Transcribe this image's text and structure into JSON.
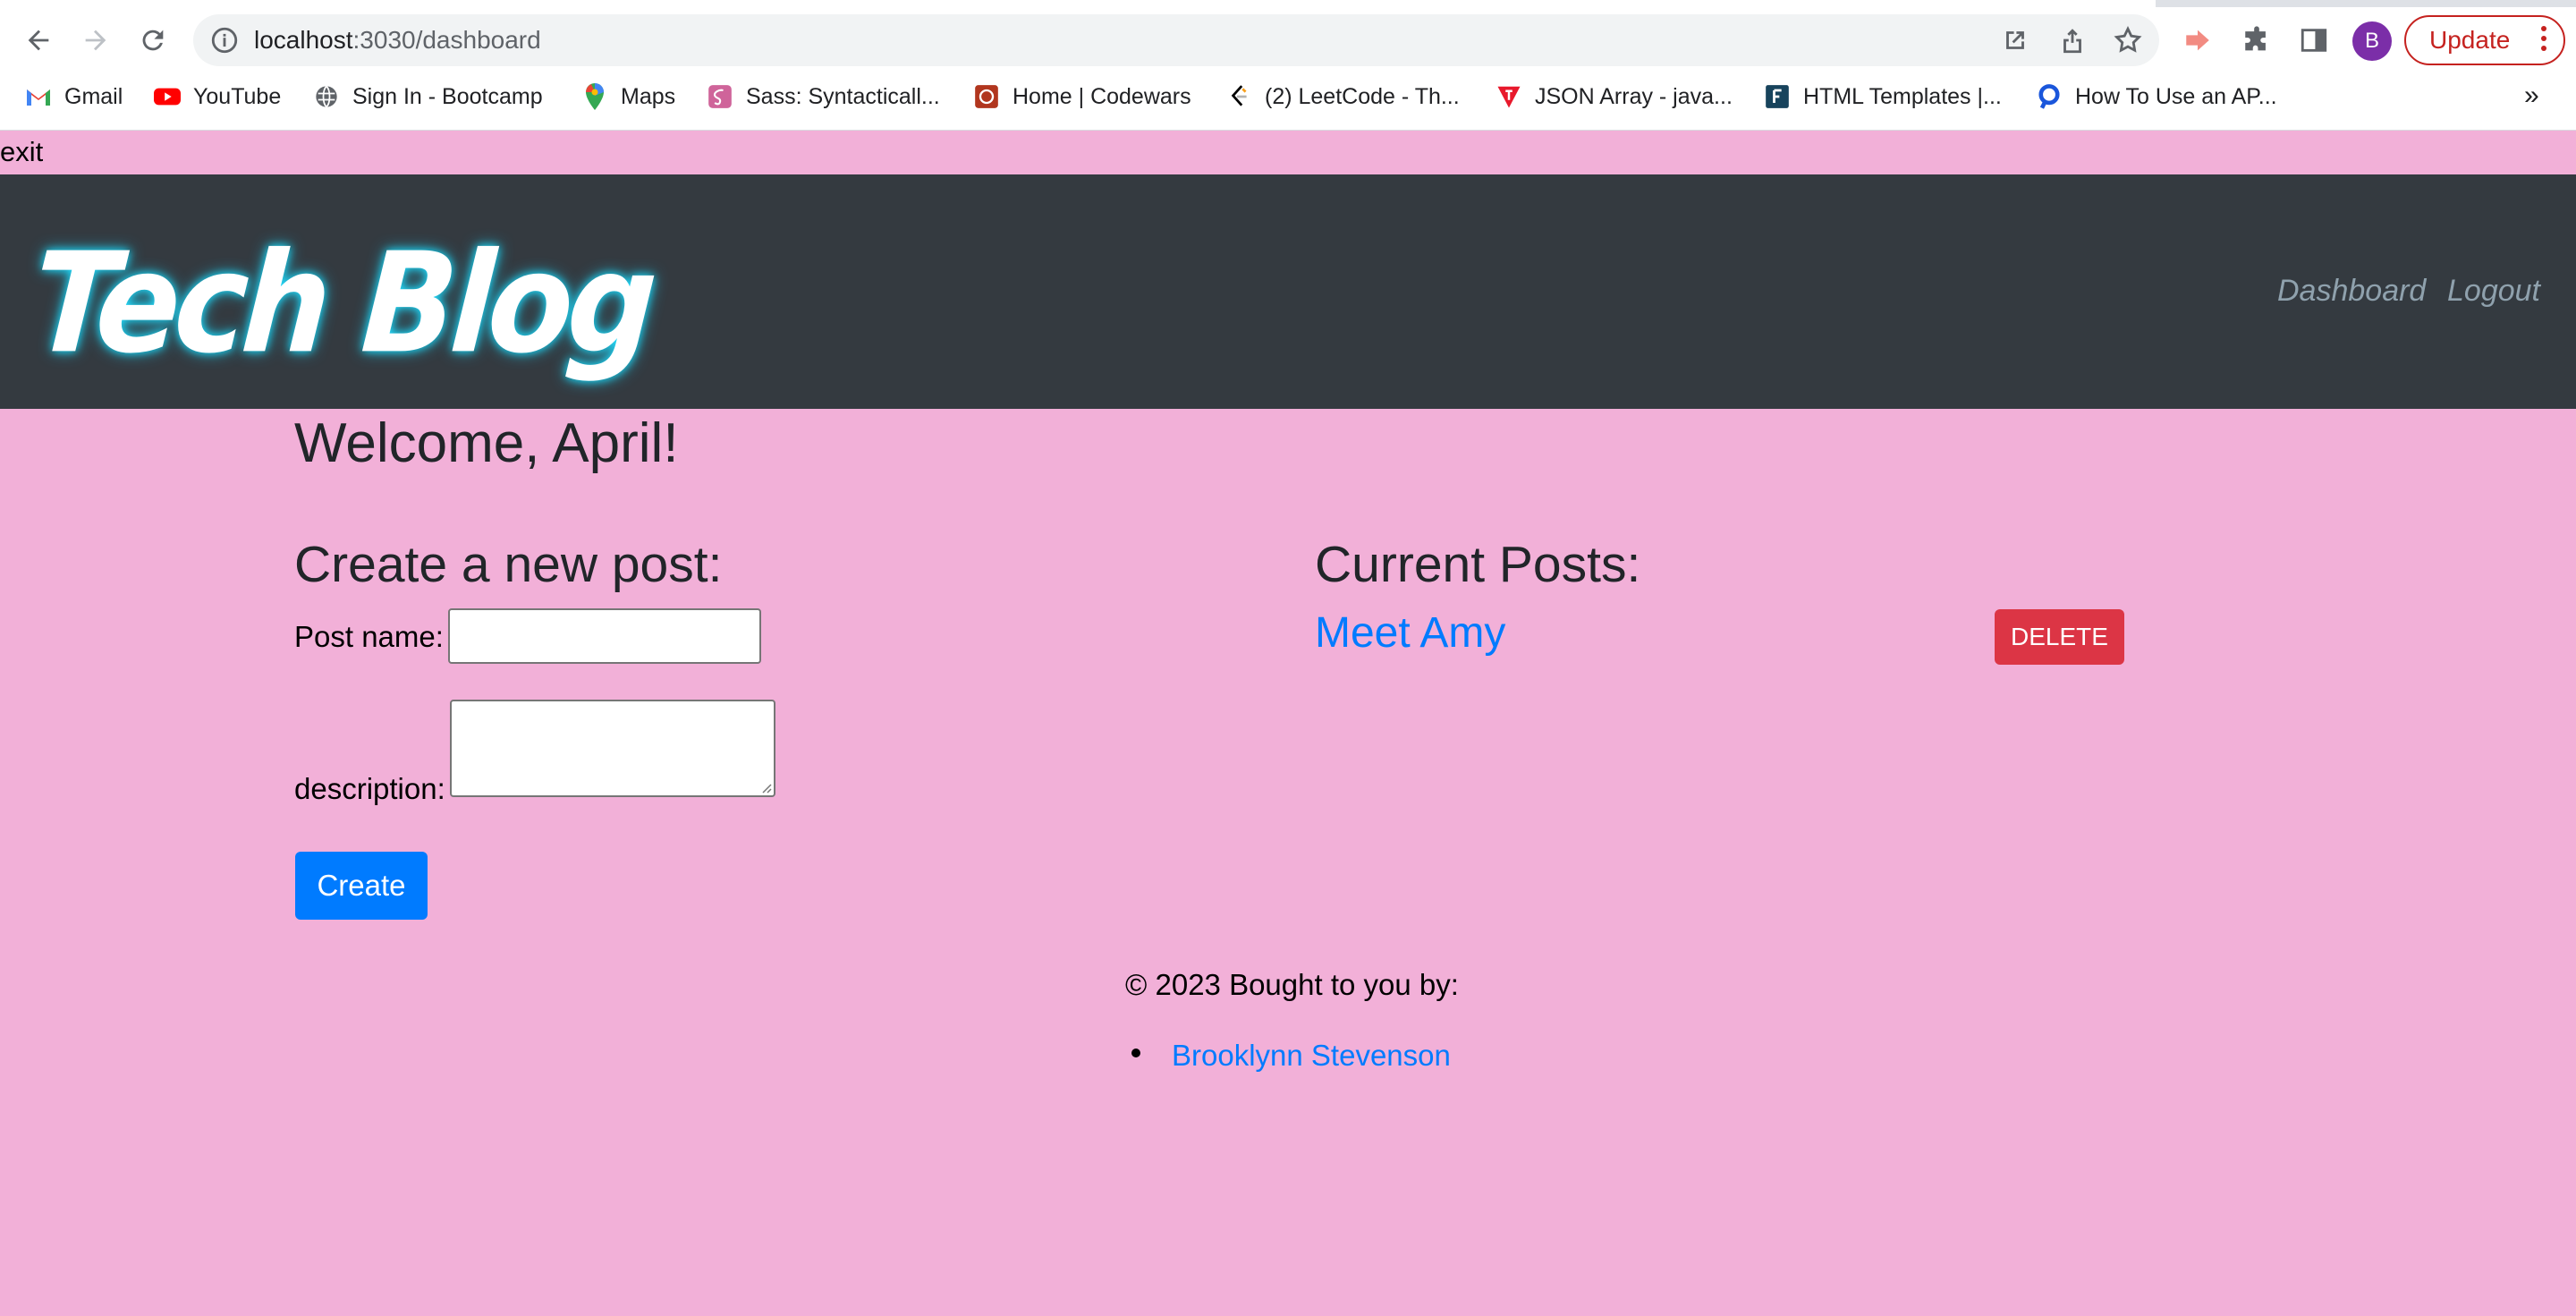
{
  "browser": {
    "url_host": "localhost",
    "url_path": ":3030/dashboard",
    "avatar_letter": "B",
    "update_label": "Update",
    "bookmarks": [
      {
        "label": "Gmail",
        "icon": "gmail-icon"
      },
      {
        "label": "YouTube",
        "icon": "youtube-icon"
      },
      {
        "label": "Sign In - Bootcamp",
        "icon": "globe-icon"
      },
      {
        "label": "Maps",
        "icon": "maps-pin-icon"
      },
      {
        "label": "Sass: Syntacticall...",
        "icon": "sass-icon"
      },
      {
        "label": "Home | Codewars",
        "icon": "codewars-icon"
      },
      {
        "label": "(2) LeetCode - Th...",
        "icon": "leetcode-icon"
      },
      {
        "label": "JSON Array - java...",
        "icon": "tutorial-icon"
      },
      {
        "label": "HTML Templates |...",
        "icon": "f-logo-icon"
      },
      {
        "label": "How To Use an AP...",
        "icon": "q-logo-icon"
      }
    ],
    "more_bookmarks": "»"
  },
  "page": {
    "exit_text": "exit",
    "logo": "Tech Blog",
    "nav": {
      "dashboard": "Dashboard",
      "logout": "Logout"
    },
    "welcome": "Welcome, April!",
    "create": {
      "heading": "Create a new post:",
      "name_label": "Post name:",
      "name_value": "",
      "description_label": "description:",
      "description_value": "",
      "button": "Create"
    },
    "posts": {
      "heading": "Current Posts:",
      "items": [
        {
          "title": "Meet Amy",
          "delete_label": "DELETE"
        }
      ]
    },
    "footer": {
      "text": "© 2023 Bought to you by:",
      "authors": [
        "Brooklynn Stevenson"
      ]
    }
  },
  "colors": {
    "page_bg": "#f2b0d8",
    "header_bg": "#343a40",
    "primary": "#007bff",
    "danger": "#dc3545"
  }
}
